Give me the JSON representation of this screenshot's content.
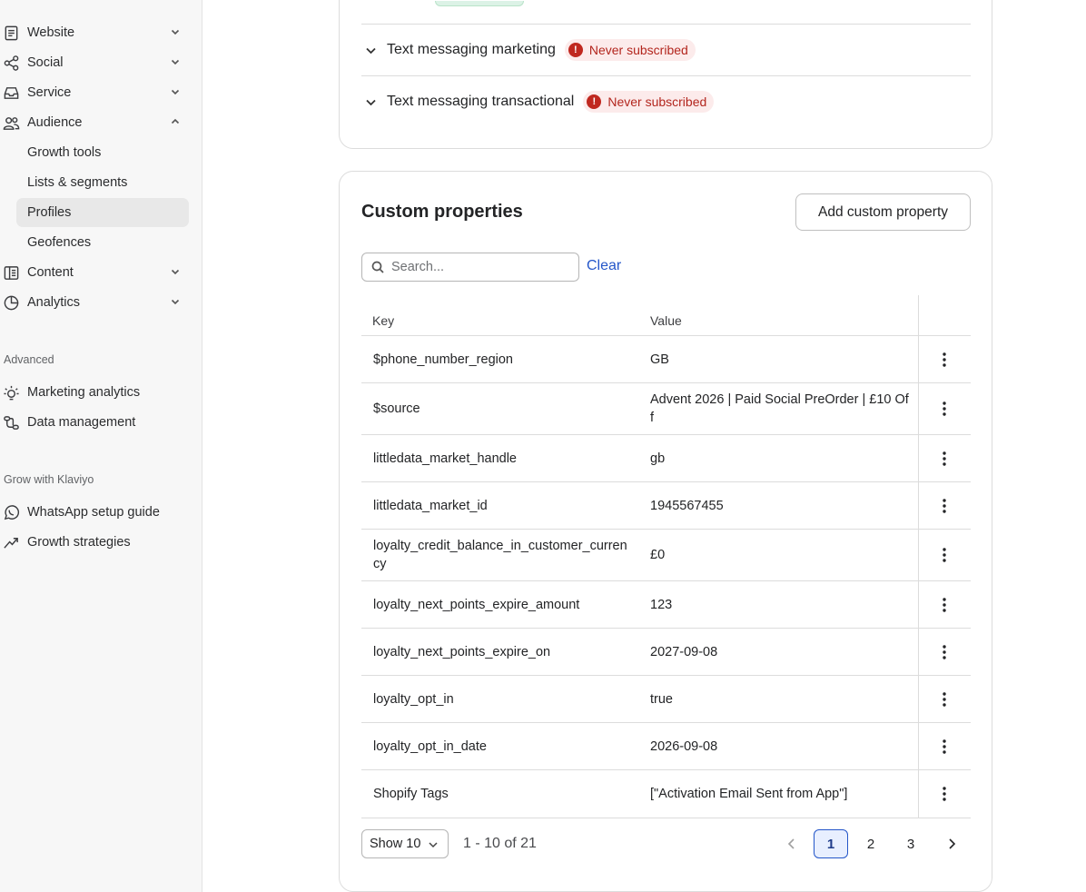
{
  "sidebar": {
    "main_items": [
      {
        "label": "Website",
        "icon": "document-icon",
        "chevron": "down"
      },
      {
        "label": "Social",
        "icon": "share-nodes-icon",
        "chevron": "down"
      },
      {
        "label": "Service",
        "icon": "inbox-icon",
        "chevron": "down"
      },
      {
        "label": "Audience",
        "icon": "people-icon",
        "chevron": "up"
      }
    ],
    "audience_sub": [
      "Growth tools",
      "Lists & segments",
      "Profiles",
      "Geofences"
    ],
    "active_sub": "Profiles",
    "more_items": [
      {
        "label": "Content",
        "icon": "content-icon",
        "chevron": "down"
      },
      {
        "label": "Analytics",
        "icon": "pie-chart-icon",
        "chevron": "down"
      }
    ],
    "advanced_label": "Advanced",
    "advanced_items": [
      {
        "label": "Marketing analytics",
        "icon": "lightbulb-icon"
      },
      {
        "label": "Data management",
        "icon": "data-flow-icon"
      }
    ],
    "grow_label": "Grow with Klaviyo",
    "grow_items": [
      {
        "label": "WhatsApp setup guide",
        "icon": "whatsapp-icon"
      },
      {
        "label": "Growth strategies",
        "icon": "trend-up-icon"
      }
    ]
  },
  "subscriptions": [
    {
      "title": "Text messaging marketing",
      "status": "Never subscribed"
    },
    {
      "title": "Text messaging transactional",
      "status": "Never subscribed"
    }
  ],
  "custom_properties": {
    "title": "Custom properties",
    "add_button": "Add custom property",
    "search_placeholder": "Search...",
    "clear_label": "Clear",
    "columns": {
      "key": "Key",
      "value": "Value"
    },
    "rows": [
      {
        "key": "$phone_number_region",
        "value": "GB"
      },
      {
        "key": "$source",
        "value": "Advent 2026 | Paid Social PreOrder | £10 Off"
      },
      {
        "key": "littledata_market_handle",
        "value": "gb"
      },
      {
        "key": "littledata_market_id",
        "value": "1945567455"
      },
      {
        "key": "loyalty_credit_balance_in_customer_currency",
        "value": "£0"
      },
      {
        "key": "loyalty_next_points_expire_amount",
        "value": "123"
      },
      {
        "key": "loyalty_next_points_expire_on",
        "value": "2027-09-08"
      },
      {
        "key": "loyalty_opt_in",
        "value": "true"
      },
      {
        "key": "loyalty_opt_in_date",
        "value": "2026-09-08"
      },
      {
        "key": "Shopify Tags",
        "value": "[\"Activation Email Sent from App\"]"
      }
    ],
    "pagination": {
      "show_label": "Show 10",
      "range_text": "1 - 10 of 21",
      "pages": [
        "1",
        "2",
        "3"
      ],
      "current_page": "1"
    }
  },
  "colors": {
    "accent": "#2456c9",
    "badge_bg": "#fcebeb",
    "badge_text": "#b3261e",
    "sidebar_bg": "#f7f7f7"
  }
}
